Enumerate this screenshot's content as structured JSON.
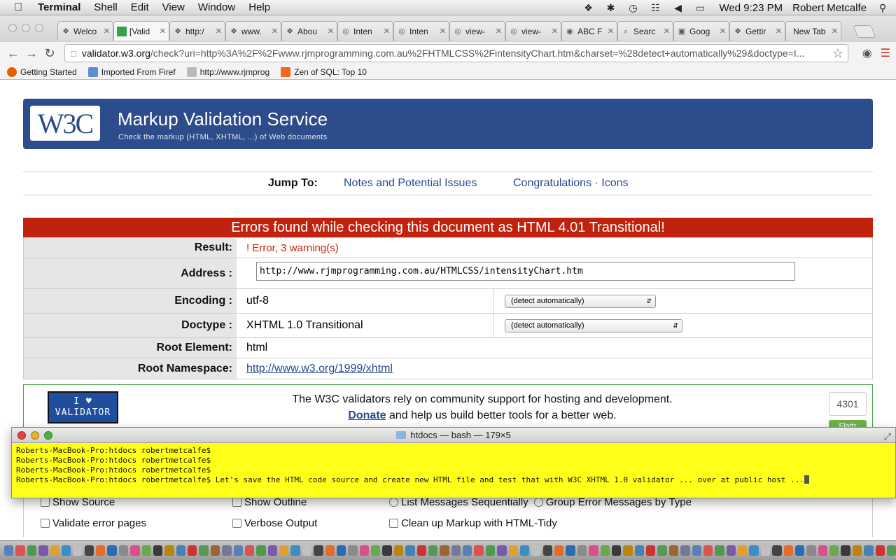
{
  "menubar": {
    "app_name": "Terminal",
    "items": [
      "Shell",
      "Edit",
      "View",
      "Window",
      "Help"
    ],
    "clock": "Wed 9:23 PM",
    "user": "Robert Metcalfe"
  },
  "tabs": [
    {
      "title": "Welco",
      "icon": "page-icon"
    },
    {
      "title": "[Valid",
      "icon": "green-square-icon"
    },
    {
      "title": "http:/",
      "icon": "page-icon"
    },
    {
      "title": "www.",
      "icon": "page-icon"
    },
    {
      "title": "Abou",
      "icon": "page-icon"
    },
    {
      "title": "Inten",
      "icon": "globe-icon"
    },
    {
      "title": "Inten",
      "icon": "globe-icon"
    },
    {
      "title": "view-",
      "icon": "globe-icon"
    },
    {
      "title": "view-",
      "icon": "globe-icon"
    },
    {
      "title": "ABC F",
      "icon": "abc-icon"
    },
    {
      "title": "Searc",
      "icon": "search-icon"
    },
    {
      "title": "Goog",
      "icon": "google-icon"
    },
    {
      "title": "Gettir",
      "icon": "dropbox-icon"
    },
    {
      "title": "New Tab",
      "icon": "none"
    }
  ],
  "omnibox": {
    "host": "validator.w3.org",
    "rest": "/check?uri=http%3A%2F%2Fwww.rjmprogramming.com.au%2FHTMLCSS%2FintensityChart.htm&charset=%28detect+automatically%29&doctype=I..."
  },
  "bookmarks": [
    {
      "label": "Getting Started",
      "color": "#e66000"
    },
    {
      "label": "Imported From Firef",
      "color": "#5b8fd0"
    },
    {
      "label": "http://www.rjmprog",
      "color": "#999999"
    },
    {
      "label": "Zen of SQL: Top 10",
      "color": "#f06a1a"
    }
  ],
  "w3c": {
    "logo": "W3C",
    "title": "Markup Validation Service",
    "subtitle": "Check the markup (HTML, XHTML, ...) of Web documents",
    "jump_label": "Jump To:",
    "jump_link1": "Notes and Potential Issues",
    "jump_link2": "Congratulations · Icons",
    "error_heading": "Errors found while checking this document as HTML 4.01 Transitional!",
    "result_label": "Result:",
    "result_value": "! Error,  3 warning(s)",
    "address_label": "Address :",
    "address_value": "http://www.rjmprogramming.com.au/HTMLCSS/intensityChart.htm",
    "encoding_label": "Encoding :",
    "encoding_value": "utf-8",
    "encoding_select": "(detect automatically)",
    "doctype_label": "Doctype :",
    "doctype_value": "XHTML 1.0 Transitional",
    "doctype_select": "(detect automatically)",
    "root_label": "Root Element:",
    "root_value": "html",
    "ns_label": "Root Namespace:",
    "ns_value": "http://www.w3.org/1999/xhtml",
    "badge_line1": "I ♥",
    "badge_line2": "VALIDATOR",
    "donate_line1": "The W3C validators rely on community support for hosting and development.",
    "donate_link": "Donate",
    "donate_line2_rest": " and help us build better tools for a better web.",
    "counter": "4301",
    "flattr": "Flattr",
    "opt_show_source": "Show Source",
    "opt_show_outline": "Show Outline",
    "opt_list_seq": "List Messages Sequentially",
    "opt_group": "Group Error Messages by Type",
    "opt_validate_error": "Validate error pages",
    "opt_verbose": "Verbose Output",
    "opt_tidy": "Clean up Markup with HTML-Tidy"
  },
  "terminal": {
    "title": "htdocs — bash — 179×5",
    "lines": [
      "Roberts-MacBook-Pro:htdocs robertmetcalfe$",
      "Roberts-MacBook-Pro:htdocs robertmetcalfe$",
      "Roberts-MacBook-Pro:htdocs robertmetcalfe$",
      "Roberts-MacBook-Pro:htdocs robertmetcalfe$ Let's save the HTML code source and create new HTML file and test that with W3C XHTML 1.0 validator ... over at public host ..."
    ],
    "background": "#ffff1a"
  },
  "colors": {
    "w3c_blue": "#2c4c8c",
    "error_red": "#c1220e",
    "link_blue": "#274a8f"
  }
}
